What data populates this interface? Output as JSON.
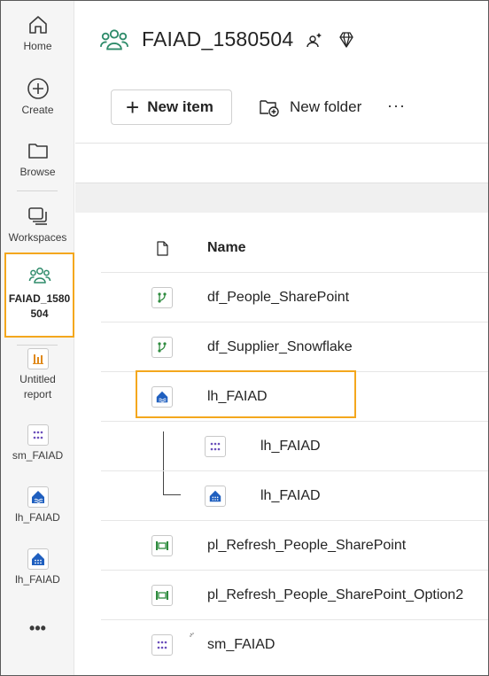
{
  "rail": {
    "home": "Home",
    "create": "Create",
    "browse": "Browse",
    "workspaces": "Workspaces",
    "active_workspace_line1": "FAIAD_1580",
    "active_workspace_line2": "504",
    "recent": [
      {
        "line1": "Untitled",
        "line2": "report",
        "icon": "report-icon"
      },
      {
        "line1": "sm_FAIAD",
        "line2": "",
        "icon": "semantic-model-icon"
      },
      {
        "line1": "lh_FAIAD",
        "line2": "",
        "icon": "lakehouse-icon"
      },
      {
        "line1": "lh_FAIAD",
        "line2": "",
        "icon": "sql-endpoint-icon"
      }
    ],
    "more": "•••"
  },
  "header": {
    "workspace_title": "FAIAD_1580504",
    "icons": [
      "workspace-icon",
      "workspace-identity-icon",
      "premium-diamond-icon"
    ]
  },
  "toolbar": {
    "new_item": "New item",
    "new_folder": "New folder",
    "more": "···"
  },
  "table": {
    "header_name": "Name",
    "rows": [
      {
        "name": "df_People_SharePoint",
        "icon": "dataflow-icon"
      },
      {
        "name": "df_Supplier_Snowflake",
        "icon": "dataflow-icon"
      },
      {
        "name": "lh_FAIAD",
        "icon": "lakehouse-icon"
      },
      {
        "name": "lh_FAIAD",
        "icon": "semantic-model-icon"
      },
      {
        "name": "lh_FAIAD",
        "icon": "sql-endpoint-icon"
      },
      {
        "name": "pl_Refresh_People_SharePoint",
        "icon": "pipeline-icon"
      },
      {
        "name": "pl_Refresh_People_SharePoint_Option2",
        "icon": "pipeline-icon"
      },
      {
        "name": "sm_FAIAD",
        "icon": "semantic-model-icon"
      }
    ]
  },
  "colors": {
    "highlight": "#f4a71d",
    "dataflow": "#2e8b3e",
    "lakehouse": "#1f5fbf",
    "semantic_model": "#6b4fbb",
    "workspace_icon": "#2e8b6a"
  }
}
